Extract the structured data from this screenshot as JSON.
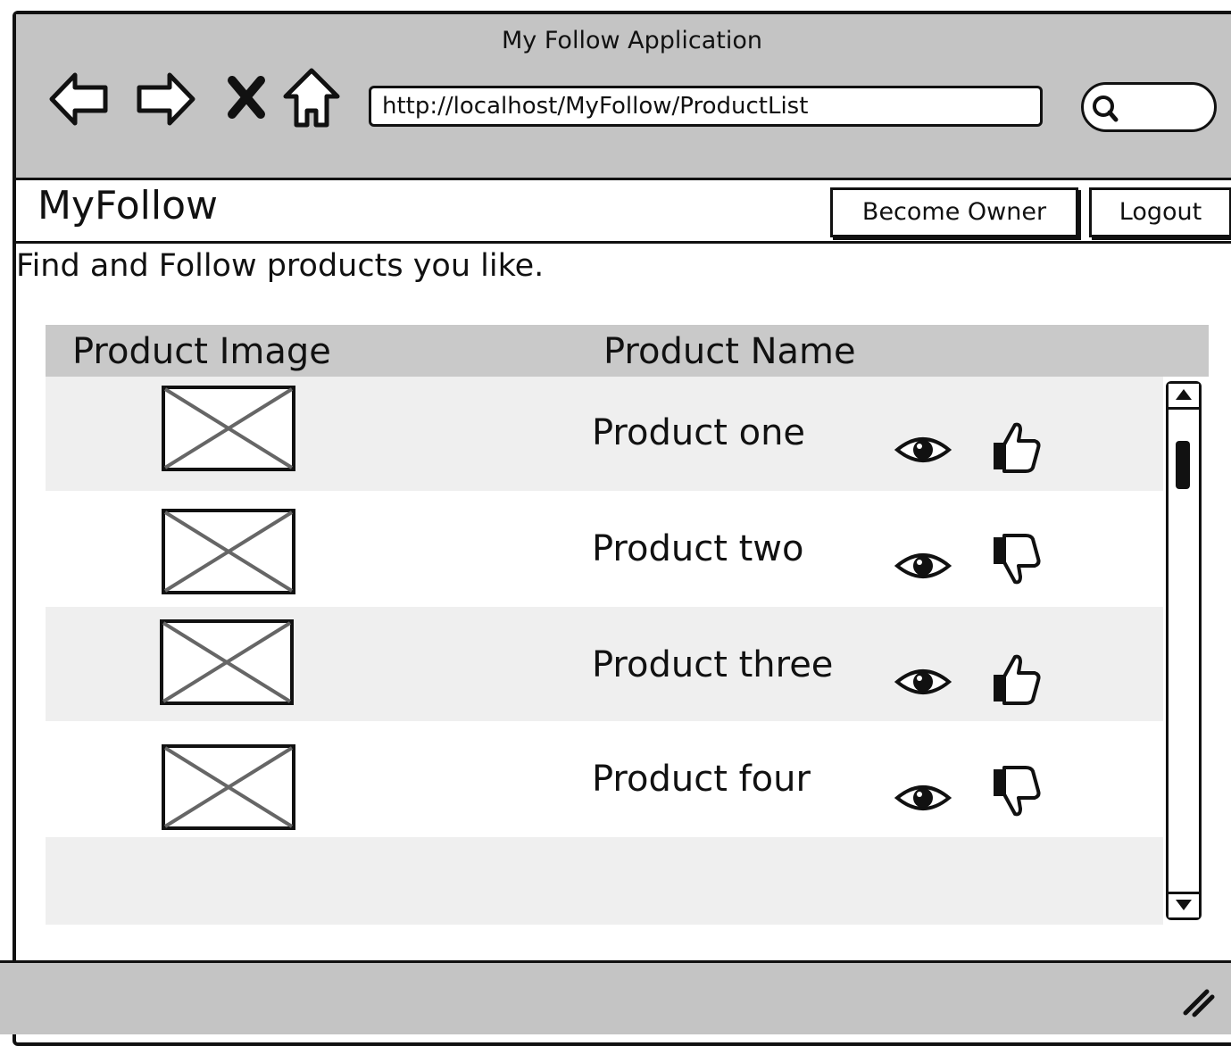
{
  "window": {
    "title": "My Follow Application"
  },
  "browser": {
    "url": "http://localhost/MyFollow/ProductList",
    "nav_icons": [
      "back-arrow-icon",
      "forward-arrow-icon",
      "stop-icon",
      "home-icon"
    ],
    "search_icon": "search-icon"
  },
  "app": {
    "brand": "MyFollow",
    "become_owner_label": "Become Owner",
    "logout_label": "Logout",
    "tagline": "Find and Follow products you like."
  },
  "table": {
    "headers": {
      "image": "Product Image",
      "name": "Product Name"
    },
    "rows": [
      {
        "name": "Product one",
        "view_icon": "eye-icon",
        "rating_icon": "thumbs-up-icon"
      },
      {
        "name": "Product two",
        "view_icon": "eye-icon",
        "rating_icon": "thumbs-down-icon"
      },
      {
        "name": "Product three",
        "view_icon": "eye-icon",
        "rating_icon": "thumbs-up-icon"
      },
      {
        "name": "Product four",
        "view_icon": "eye-icon",
        "rating_icon": "thumbs-down-icon"
      }
    ]
  },
  "colors": {
    "chrome": "#c4c4c4",
    "header_row": "#c9c9c9",
    "zebra_row": "#efefef",
    "ink": "#111111"
  }
}
